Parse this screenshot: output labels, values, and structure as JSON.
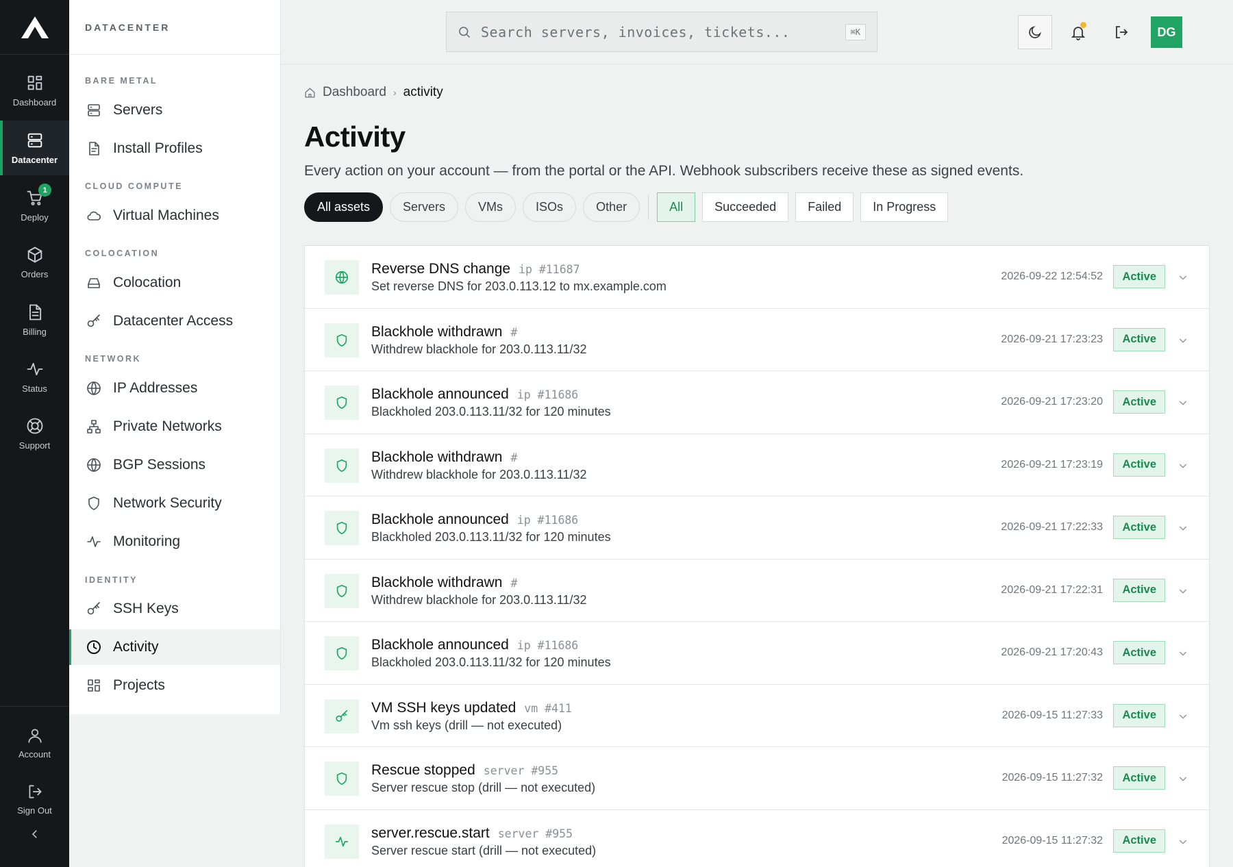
{
  "rail": {
    "items": [
      {
        "label": "Dashboard",
        "icon": "grid-icon"
      },
      {
        "label": "Datacenter",
        "icon": "server-icon",
        "active": true
      },
      {
        "label": "Deploy",
        "icon": "cart-icon",
        "badge": "1"
      },
      {
        "label": "Orders",
        "icon": "box-icon"
      },
      {
        "label": "Billing",
        "icon": "document-icon"
      },
      {
        "label": "Status",
        "icon": "pulse-icon"
      },
      {
        "label": "Support",
        "icon": "lifebuoy-icon"
      }
    ],
    "bottom": [
      {
        "label": "Account",
        "icon": "user-icon"
      },
      {
        "label": "Sign Out",
        "icon": "logout-icon"
      }
    ]
  },
  "sidebar": {
    "title": "DATACENTER",
    "sections": [
      {
        "label": "BARE METAL"
      },
      {
        "label": "CLOUD COMPUTE"
      },
      {
        "label": "COLOCATION"
      },
      {
        "label": "NETWORK"
      },
      {
        "label": "IDENTITY"
      }
    ],
    "items": [
      {
        "label": "Servers",
        "icon": "server-icon"
      },
      {
        "label": "Install Profiles",
        "icon": "file-icon"
      },
      {
        "label": "Virtual Machines",
        "icon": "cloud-icon"
      },
      {
        "label": "Colocation",
        "icon": "drive-icon"
      },
      {
        "label": "Datacenter Access",
        "icon": "key-icon"
      },
      {
        "label": "IP Addresses",
        "icon": "globe-icon"
      },
      {
        "label": "Private Networks",
        "icon": "network-icon"
      },
      {
        "label": "BGP Sessions",
        "icon": "globe-icon"
      },
      {
        "label": "Network Security",
        "icon": "shield-icon"
      },
      {
        "label": "Monitoring",
        "icon": "pulse-icon"
      },
      {
        "label": "SSH Keys",
        "icon": "key-icon"
      },
      {
        "label": "Activity",
        "icon": "clock-icon",
        "active": true
      },
      {
        "label": "Projects",
        "icon": "grid-icon"
      }
    ]
  },
  "topbar": {
    "search_placeholder": "Search servers, invoices, tickets...",
    "shortcut": "⌘K",
    "user_initials": "DG"
  },
  "breadcrumb": {
    "home": "Dashboard",
    "current": "activity"
  },
  "page": {
    "title": "Activity",
    "subtitle": "Every action on your account — from the portal or the API. Webhook subscribers receive these as signed events."
  },
  "filters": {
    "asset": [
      "All assets",
      "Servers",
      "VMs",
      "ISOs",
      "Other"
    ],
    "asset_active": "All assets",
    "status": [
      "All",
      "Succeeded",
      "Failed",
      "In Progress"
    ],
    "status_active": "All"
  },
  "activity": [
    {
      "title": "Reverse DNS change",
      "type": "ip",
      "ref": "#11687",
      "desc": "Set reverse DNS for 203.0.113.12 to mx.example.com",
      "time": "2026-09-22 12:54:52",
      "status": "Active",
      "icon": "globe-icon"
    },
    {
      "title": "Blackhole withdrawn",
      "type": "",
      "ref": "#",
      "desc": "Withdrew blackhole for 203.0.113.11/32",
      "time": "2026-09-21 17:23:23",
      "status": "Active",
      "icon": "shield-icon"
    },
    {
      "title": "Blackhole announced",
      "type": "ip",
      "ref": "#11686",
      "desc": "Blackholed 203.0.113.11/32 for 120 minutes",
      "time": "2026-09-21 17:23:20",
      "status": "Active",
      "icon": "shield-icon"
    },
    {
      "title": "Blackhole withdrawn",
      "type": "",
      "ref": "#",
      "desc": "Withdrew blackhole for 203.0.113.11/32",
      "time": "2026-09-21 17:23:19",
      "status": "Active",
      "icon": "shield-icon"
    },
    {
      "title": "Blackhole announced",
      "type": "ip",
      "ref": "#11686",
      "desc": "Blackholed 203.0.113.11/32 for 120 minutes",
      "time": "2026-09-21 17:22:33",
      "status": "Active",
      "icon": "shield-icon"
    },
    {
      "title": "Blackhole withdrawn",
      "type": "",
      "ref": "#",
      "desc": "Withdrew blackhole for 203.0.113.11/32",
      "time": "2026-09-21 17:22:31",
      "status": "Active",
      "icon": "shield-icon"
    },
    {
      "title": "Blackhole announced",
      "type": "ip",
      "ref": "#11686",
      "desc": "Blackholed 203.0.113.11/32 for 120 minutes",
      "time": "2026-09-21 17:20:43",
      "status": "Active",
      "icon": "shield-icon"
    },
    {
      "title": "VM SSH keys updated",
      "type": "vm",
      "ref": "#411",
      "desc": "Vm ssh keys (drill — not executed)",
      "time": "2026-09-15 11:27:33",
      "status": "Active",
      "icon": "key-icon"
    },
    {
      "title": "Rescue stopped",
      "type": "server",
      "ref": "#955",
      "desc": "Server rescue stop (drill — not executed)",
      "time": "2026-09-15 11:27:32",
      "status": "Active",
      "icon": "shield-icon"
    },
    {
      "title": "server.rescue.start",
      "type": "server",
      "ref": "#955",
      "desc": "Server rescue start (drill — not executed)",
      "time": "2026-09-15 11:27:32",
      "status": "Active",
      "icon": "pulse-icon"
    }
  ],
  "colors": {
    "accent": "#1fa463",
    "rail_bg": "#14181b",
    "badge_bg": "#e3f4ea",
    "bell_dot": "#f2b92b"
  }
}
